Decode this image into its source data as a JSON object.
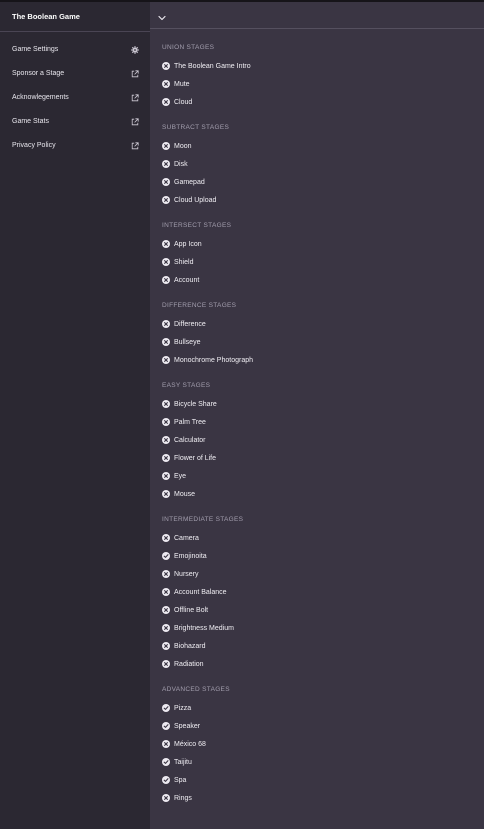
{
  "app": {
    "title": "The Boolean Game"
  },
  "sidebar": {
    "items": [
      {
        "label": "Game Settings",
        "icon": "gear-icon"
      },
      {
        "label": "Sponsor a Stage",
        "icon": "external-link-icon"
      },
      {
        "label": "Acknowlegements",
        "icon": "external-link-icon"
      },
      {
        "label": "Game Stats",
        "icon": "external-link-icon"
      },
      {
        "label": "Privacy Policy",
        "icon": "external-link-icon"
      }
    ]
  },
  "sections": [
    {
      "title": "UNION STAGES",
      "stages": [
        {
          "label": "The Boolean Game Intro",
          "status": "x"
        },
        {
          "label": "Mute",
          "status": "x"
        },
        {
          "label": "Cloud",
          "status": "x"
        }
      ]
    },
    {
      "title": "SUBTRACT STAGES",
      "stages": [
        {
          "label": "Moon",
          "status": "x"
        },
        {
          "label": "Disk",
          "status": "x"
        },
        {
          "label": "Gamepad",
          "status": "x"
        },
        {
          "label": "Cloud Upload",
          "status": "x"
        }
      ]
    },
    {
      "title": "INTERSECT STAGES",
      "stages": [
        {
          "label": "App Icon",
          "status": "x"
        },
        {
          "label": "Shield",
          "status": "x"
        },
        {
          "label": "Account",
          "status": "x"
        }
      ]
    },
    {
      "title": "DIFFERENCE STAGES",
      "stages": [
        {
          "label": "Difference",
          "status": "x"
        },
        {
          "label": "Bullseye",
          "status": "x"
        },
        {
          "label": "Monochrome Photograph",
          "status": "x"
        }
      ]
    },
    {
      "title": "EASY STAGES",
      "stages": [
        {
          "label": "Bicycle Share",
          "status": "x"
        },
        {
          "label": "Palm Tree",
          "status": "x"
        },
        {
          "label": "Calculator",
          "status": "x"
        },
        {
          "label": "Flower of Life",
          "status": "x"
        },
        {
          "label": "Eye",
          "status": "x"
        },
        {
          "label": "Mouse",
          "status": "x"
        }
      ]
    },
    {
      "title": "INTERMEDIATE STAGES",
      "stages": [
        {
          "label": "Camera",
          "status": "x"
        },
        {
          "label": "Emojinoita",
          "status": "check"
        },
        {
          "label": "Nursery",
          "status": "x"
        },
        {
          "label": "Account Balance",
          "status": "x"
        },
        {
          "label": "Offline Bolt",
          "status": "x"
        },
        {
          "label": "Brightness Medium",
          "status": "x"
        },
        {
          "label": "Biohazard",
          "status": "x"
        },
        {
          "label": "Radiation",
          "status": "x"
        }
      ]
    },
    {
      "title": "ADVANCED STAGES",
      "stages": [
        {
          "label": "Pizza",
          "status": "check"
        },
        {
          "label": "Speaker",
          "status": "check"
        },
        {
          "label": "México 68",
          "status": "x"
        },
        {
          "label": "Taijitu",
          "status": "check"
        },
        {
          "label": "Spa",
          "status": "check"
        },
        {
          "label": "Rings",
          "status": "x"
        }
      ]
    }
  ],
  "colors": {
    "sidebar_bg": "#2b2832",
    "main_bg": "#3a3543",
    "section_title": "#a39eae",
    "status_disc": "#ece9f0",
    "status_glyph": "#3a3543"
  }
}
